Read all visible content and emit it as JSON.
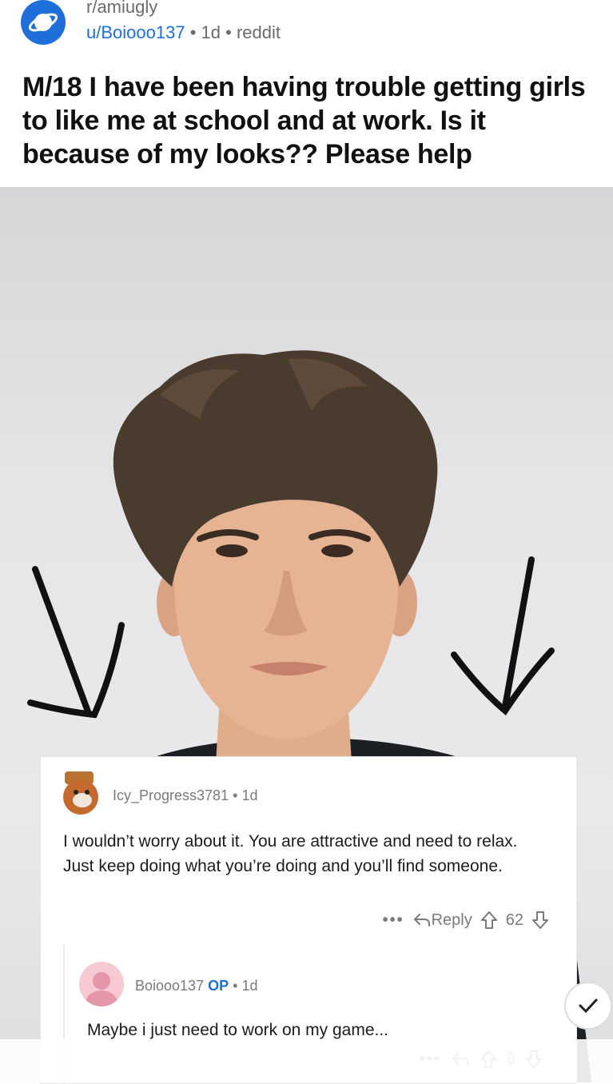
{
  "post": {
    "subreddit": "r/amiugly",
    "author": "u/Boiooo137",
    "age": "1d",
    "source": "reddit",
    "separator": "•",
    "title": "M/18 I have been having trouble getting girls to like me at school and at work. Is it because of my looks?? Please help"
  },
  "comment": {
    "author": "Icy_Progress3781",
    "age": "1d",
    "separator": "•",
    "body": "I wouldn’t worry about it. You are attractive and need to relax. Just keep doing what you’re doing and you’ll find someone.",
    "more_label": "•••",
    "reply_label": "Reply",
    "votes": "62"
  },
  "reply": {
    "author": "Boiooo137",
    "op_badge": "OP",
    "age": "1d",
    "separator": "•",
    "body": "Maybe i just need to work on my game...",
    "more_label": "•••",
    "votes": "8"
  },
  "colors": {
    "accent": "#1e6fd9",
    "meta": "#6b6b6b",
    "text": "#111111"
  }
}
